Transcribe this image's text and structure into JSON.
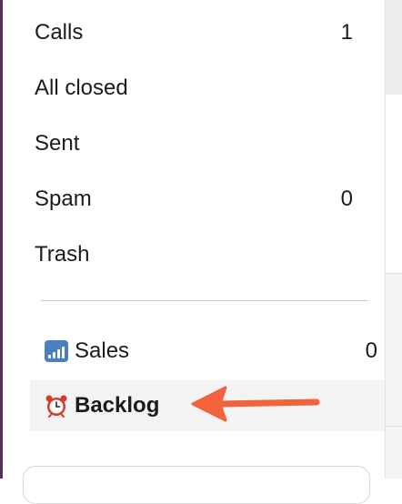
{
  "folders_list": [
    {
      "label": "Calls",
      "count": "1"
    },
    {
      "label": "All closed",
      "count": ""
    },
    {
      "label": "Sent",
      "count": ""
    },
    {
      "label": "Spam",
      "count": "0"
    },
    {
      "label": "Trash",
      "count": ""
    }
  ],
  "custom_folders": [
    {
      "icon": "signal-bars-icon",
      "label": "Sales",
      "count": "0"
    },
    {
      "icon": "alarm-clock-icon",
      "label": "Backlog",
      "count": "",
      "active": true
    }
  ],
  "annotation": {
    "icon": "pointer-arrow-icon",
    "color": "#f2623c"
  },
  "colors": {
    "active_background": "#f3f3f4",
    "left_accent": "#5a2e5a",
    "sales_icon": "#4a7fc1"
  }
}
